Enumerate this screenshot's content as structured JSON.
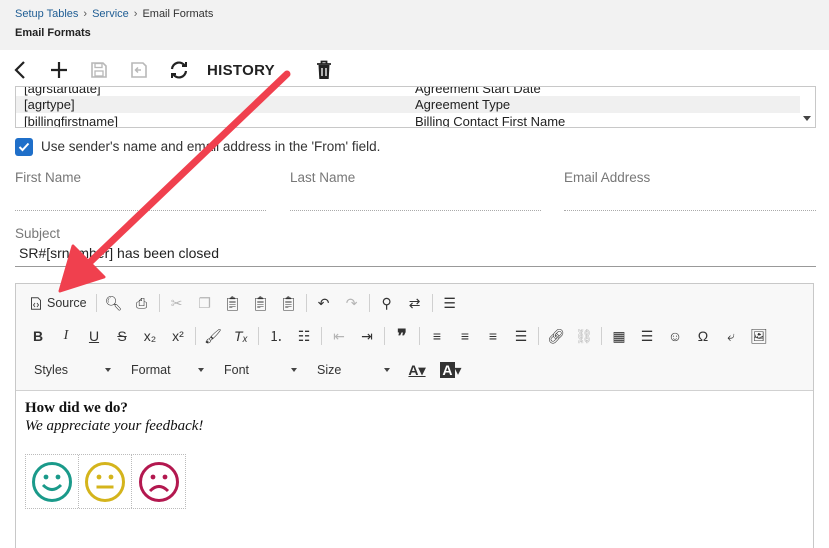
{
  "breadcrumb": {
    "items": [
      "Setup Tables",
      "Service",
      "Email Formats"
    ]
  },
  "page_title": "Email Formats",
  "actions": {
    "history_label": "HISTORY"
  },
  "merge_fields": [
    {
      "key": "[agrstartdate]",
      "label": "Agreement Start Date"
    },
    {
      "key": "[agrtype]",
      "label": "Agreement Type"
    },
    {
      "key": "[billingfirstname]",
      "label": "Billing Contact First Name"
    }
  ],
  "sender_option": {
    "label": "Use sender's name and email address in the 'From' field.",
    "checked": true
  },
  "fields": {
    "first_name": "First Name",
    "last_name": "Last Name",
    "email_address": "Email Address"
  },
  "subject": {
    "label": "Subject",
    "value": "SR#[srnumber] has been closed"
  },
  "editor": {
    "source_label": "Source",
    "combos": [
      "Styles",
      "Format",
      "Font",
      "Size"
    ],
    "content_heading": "How did we do?",
    "content_text": "We appreciate your feedback!",
    "faces": [
      {
        "icon": "happy-face-icon",
        "color": "#1a9a8a"
      },
      {
        "icon": "neutral-face-icon",
        "color": "#d4b41c"
      },
      {
        "icon": "sad-face-icon",
        "color": "#b3184f"
      }
    ]
  },
  "colors": {
    "link": "#1f5d94",
    "checkbox": "#1f6fc9",
    "annotation_arrow": "#f0404e"
  }
}
